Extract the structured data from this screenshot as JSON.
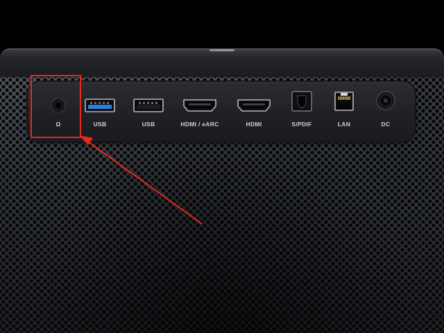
{
  "ports": [
    {
      "id": "headphone",
      "label": "Ω",
      "icon": "headphone-jack-icon"
    },
    {
      "id": "usb1",
      "label": "USB",
      "icon": "usb3-port-icon",
      "accent": "#2f7de1"
    },
    {
      "id": "usb2",
      "label": "USB",
      "icon": "usb2-port-icon"
    },
    {
      "id": "hdmi-earc",
      "label": "HDMI / eARC",
      "icon": "hdmi-port-icon"
    },
    {
      "id": "hdmi",
      "label": "HDMI",
      "icon": "hdmi-port-icon"
    },
    {
      "id": "spdif",
      "label": "S/PDIF",
      "icon": "optical-port-icon"
    },
    {
      "id": "lan",
      "label": "LAN",
      "icon": "ethernet-port-icon"
    },
    {
      "id": "dc",
      "label": "DC",
      "icon": "dc-power-jack-icon"
    }
  ],
  "annotation": {
    "color": "#e8291f",
    "target": "headphone",
    "shapes": [
      "highlight-box",
      "pointer-arrow"
    ]
  },
  "colors": {
    "background": "#000000",
    "panel": "#1f2124",
    "label": "#d2d3d6",
    "usb_blue": "#2f7de1"
  }
}
